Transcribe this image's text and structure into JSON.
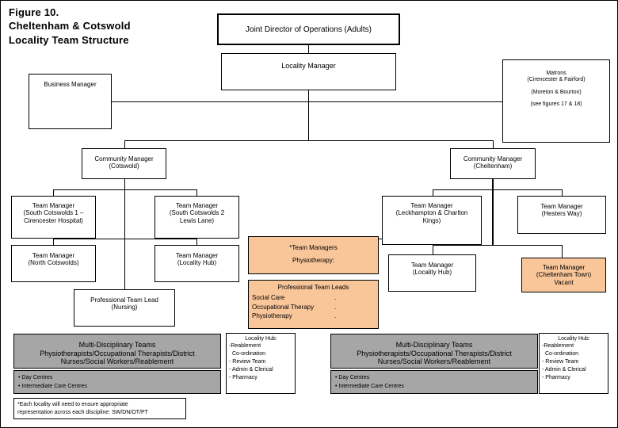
{
  "title": {
    "line1": "Figure 10.",
    "line2": "Cheltenham & Cotswold",
    "line3": "Locality Team Structure"
  },
  "colors": {
    "orange": "#f9c69a",
    "gray": "#a6a6a6",
    "line": "#000000",
    "background": "#ffffff"
  },
  "nodes": {
    "joint_director": {
      "line1": "Joint Director of Operations (Adults)"
    },
    "locality_manager": {
      "line1": "Locality Manager"
    },
    "business_manager": {
      "line1": "Business Manager"
    },
    "matrons": {
      "line1": "Matrons",
      "line2": "(Cirencester & Fairford)",
      "line3": "(Moreton & Bourton)",
      "line4": "(see figures 17 & 18)"
    },
    "community_manager_cotswold": {
      "line1": "Community Manager",
      "line2": "(Cotswold)"
    },
    "community_manager_cheltenham": {
      "line1": "Community Manager",
      "line2": "(Cheltenham)"
    },
    "tm_south_cotswolds_1": {
      "line1": "Team Manager",
      "line2": "(South Cotswolds 1 –",
      "line3": "Cirencester Hospital)"
    },
    "tm_south_cotswolds_2": {
      "line1": "Team Manager",
      "line2": "(South Cotswolds 2",
      "line3": "Lewis Lane)"
    },
    "tm_north_cotswolds": {
      "line1": "Team Manager",
      "line2": "(North Cotswolds)"
    },
    "tm_locality_hub_left": {
      "line1": "Team Manager",
      "line2": "(Locality Hub)"
    },
    "ptl_nursing": {
      "line1": "Professional Team Lead",
      "line2": "(Nursing)"
    },
    "tm_leckhampton": {
      "line1": "Team Manager",
      "line2": "(Leckhampton & Charlton",
      "line3": "Kings)"
    },
    "tm_hesters_way": {
      "line1": "Team Manager",
      "line2": "(Hesters Way)"
    },
    "tm_locality_hub_right": {
      "line1": "Team Manager",
      "line2": "(Locality Hub)"
    },
    "tm_cheltenham_town": {
      "line1": "Team Manager",
      "line2": "(Cheltenham Town)",
      "line3": "Vacant"
    },
    "team_managers_physio": {
      "line1": "*Team Managers",
      "line2": "Physiotherapy:"
    }
  },
  "professional_team_leads": {
    "heading": "Professional Team Leads",
    "rows": [
      {
        "label": "Social Care",
        "value": "."
      },
      {
        "label": "Occupational Therapy",
        "value": "."
      },
      {
        "label": "Physiotherapy",
        "value": "."
      }
    ]
  },
  "mdt_left": {
    "line1": "Multi-Disciplinary Teams",
    "line2": "Physiotherapists/Occupational Therapists/District",
    "line3": "Nurses/Social Workers/Reablement",
    "sub": [
      "• Day Centres",
      "• Intermediate Care Centres"
    ]
  },
  "mdt_right": {
    "line1": "Multi-Disciplinary Teams",
    "line2": "Physiotherapists/Occupational Therapists/District",
    "line3": "Nurses/Social Workers/Reablement",
    "sub": [
      "• Day Centres",
      "• Intermediate Care Centres"
    ]
  },
  "locality_hub_left": {
    "heading": "Locality Hub:",
    "items": [
      "-Reablement",
      "Co-ordination",
      "- Review Team",
      "- Admin & Clerical",
      "- Pharmacy"
    ]
  },
  "locality_hub_right": {
    "heading": "Locality Hub:",
    "items": [
      "-Reablement",
      "Co-ordination",
      "- Review Team",
      "- Admin & Clerical",
      "- Pharmacy"
    ]
  },
  "footnote": {
    "line1": "*Each locality will need to ensure appropriate",
    "line2": "representation across each discipline: SW/DN/OT/PT"
  }
}
